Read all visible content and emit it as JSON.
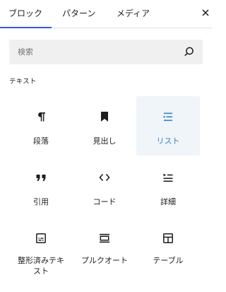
{
  "tabs": [
    {
      "label": "ブロック",
      "active": true
    },
    {
      "label": "パターン",
      "active": false
    },
    {
      "label": "メディア",
      "active": false
    }
  ],
  "search": {
    "placeholder": "検索"
  },
  "section": {
    "title": "テキスト"
  },
  "blocks": [
    {
      "label": "段落",
      "icon": "paragraph-icon"
    },
    {
      "label": "見出し",
      "icon": "heading-bookmark-icon"
    },
    {
      "label": "リスト",
      "icon": "list-icon",
      "selected": true
    },
    {
      "label": "引用",
      "icon": "quote-icon"
    },
    {
      "label": "コード",
      "icon": "code-icon"
    },
    {
      "label": "詳細",
      "icon": "details-icon"
    },
    {
      "label": "整形済みテキ\nスト",
      "icon": "preformatted-icon"
    },
    {
      "label": "プルクオート",
      "icon": "pullquote-icon"
    },
    {
      "label": "テーブル",
      "icon": "table-icon"
    }
  ],
  "colors": {
    "accent": "#3858e9",
    "selected_bg": "#f0f5fa",
    "selected_text": "#3582c4"
  }
}
